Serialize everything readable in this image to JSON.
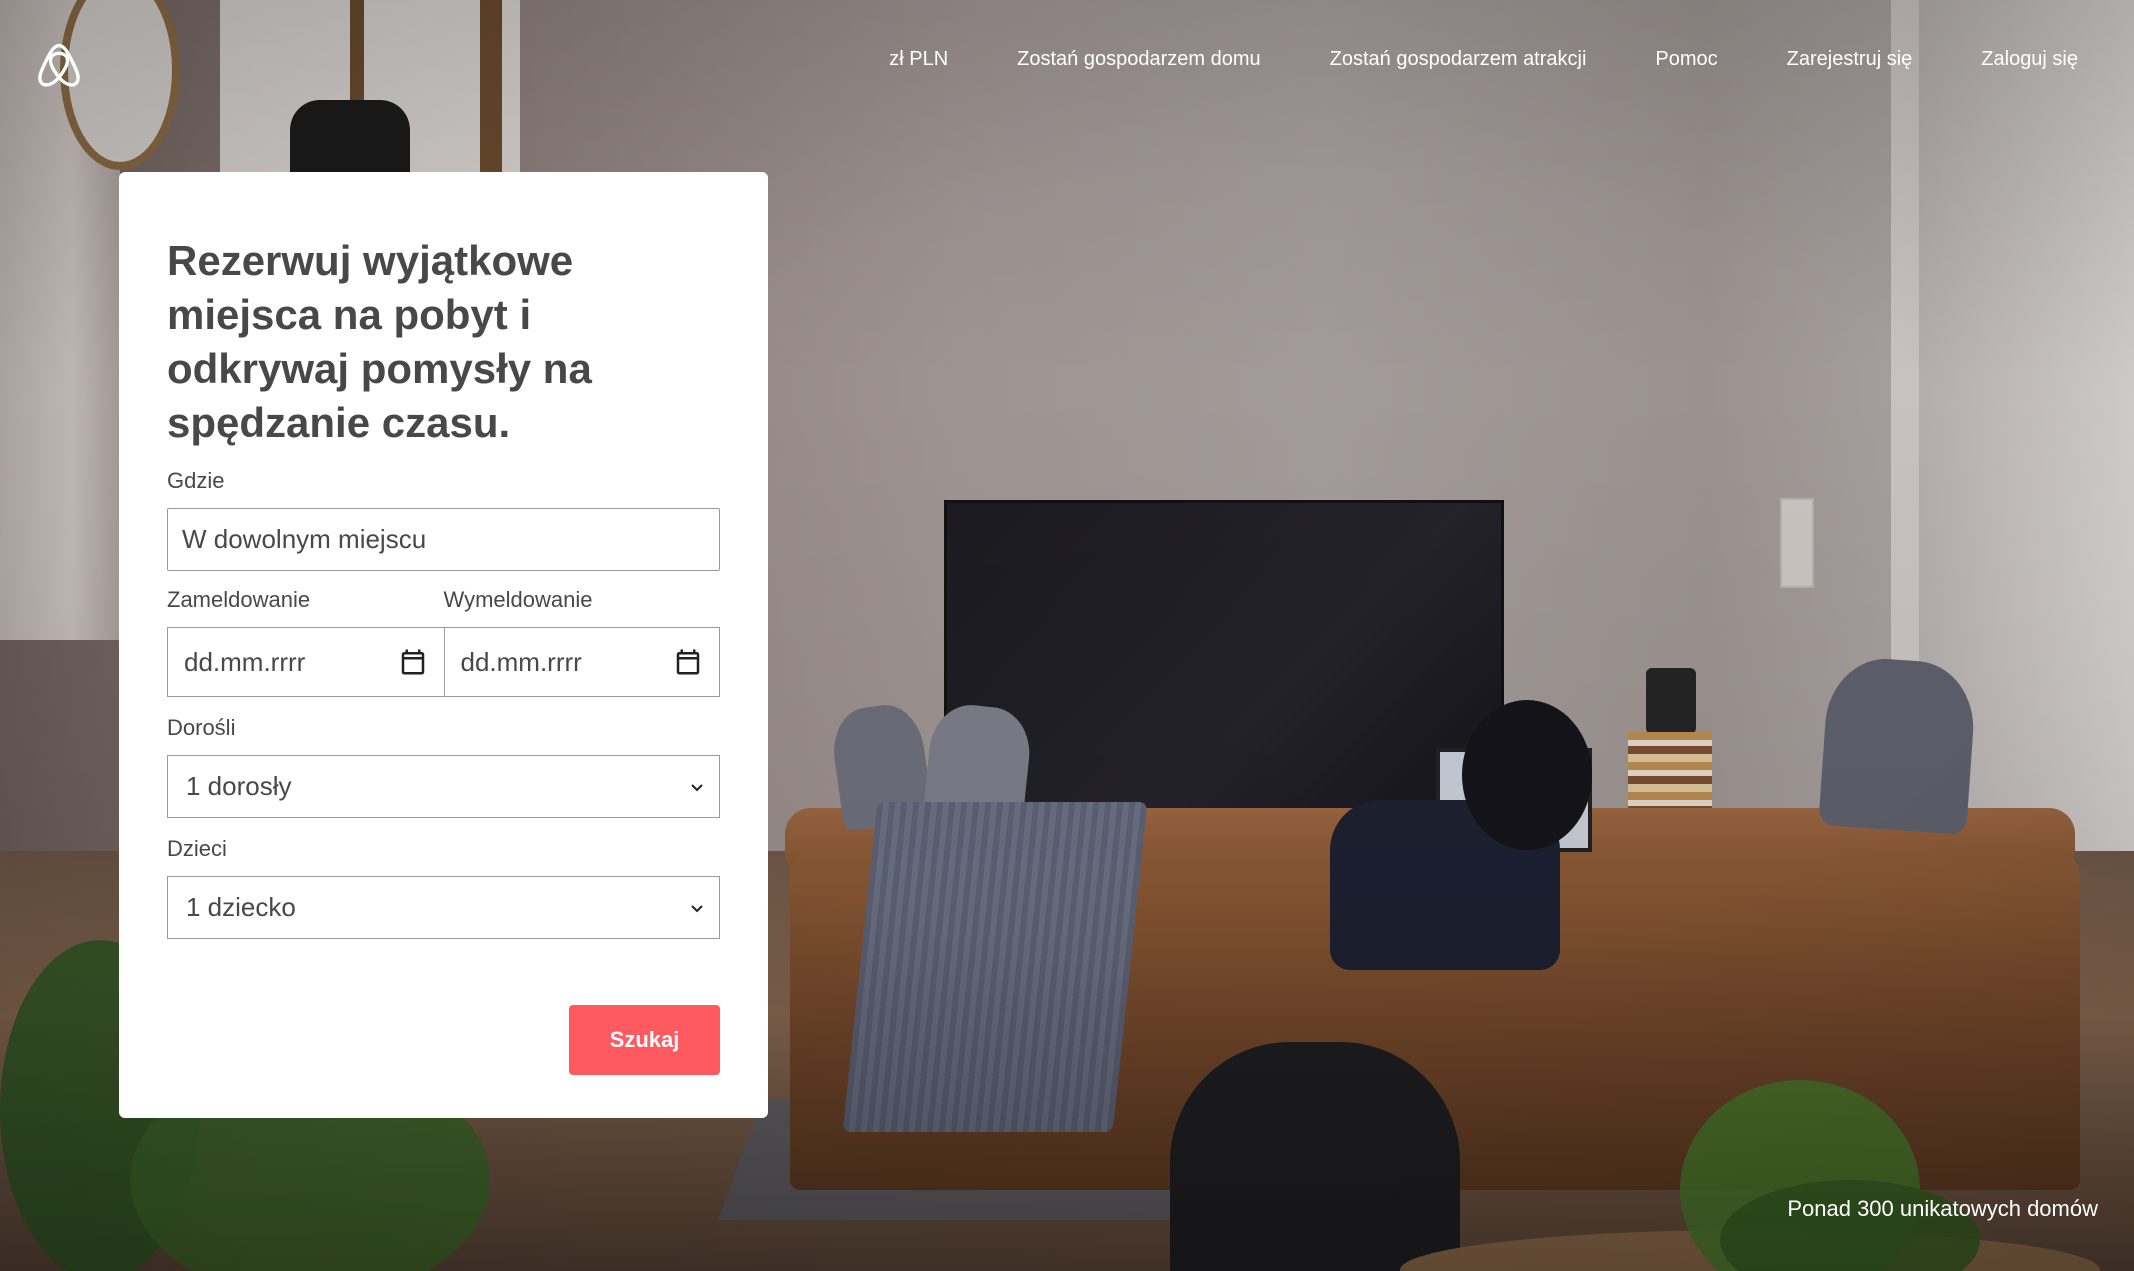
{
  "brand": {
    "logo_icon": "airbnb-belo-icon",
    "accent": "#ff5a5f"
  },
  "nav": {
    "items": [
      {
        "label": "zł PLN"
      },
      {
        "label": "Zostań gospodarzem domu"
      },
      {
        "label": "Zostań gospodarzem atrakcji"
      },
      {
        "label": "Pomoc"
      },
      {
        "label": "Zarejestruj się"
      },
      {
        "label": "Zaloguj się"
      }
    ]
  },
  "search": {
    "title": "Rezerwuj wyjątkowe miejsca na pobyt i odkrywaj pomysły na spędzanie czasu.",
    "where_label": "Gdzie",
    "where_placeholder": "W dowolnym miejscu",
    "checkin_label": "Zameldowanie",
    "checkin_placeholder": "dd.mm.rrrr",
    "checkout_label": "Wymeldowanie",
    "checkout_placeholder": "dd.mm.rrrr",
    "adults_label": "Dorośli",
    "adults_value": "1 dorosły",
    "children_label": "Dzieci",
    "children_value": "1 dziecko",
    "submit_label": "Szukaj"
  },
  "caption": "Ponad 300 unikatowych domów"
}
